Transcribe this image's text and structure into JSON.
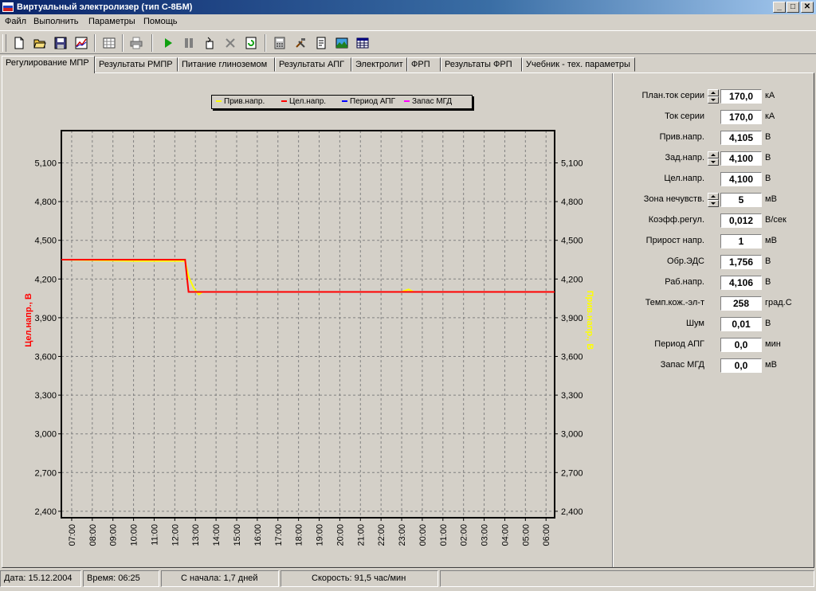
{
  "window": {
    "title": "Виртуальный электролизер (тип С-8БМ)"
  },
  "menu": [
    "Файл",
    "Выполнить",
    "Параметры",
    "Помощь"
  ],
  "toolbar": {
    "buttons": [
      "new-icon",
      "open-icon",
      "save-icon",
      "chart-icon",
      "grid-icon",
      "print-icon",
      "play-icon",
      "pause-icon",
      "step-icon",
      "stop-icon",
      "refresh-icon",
      "calculator-icon",
      "tools-icon",
      "notes-icon",
      "landscape-icon",
      "table-icon"
    ]
  },
  "tabs": [
    "Регулирование МПР",
    "Результаты РМПР",
    "Питание глиноземом",
    "Результаты АПГ",
    "Электролит",
    "ФРП",
    "Результаты ФРП",
    "Учебник - тех. параметры"
  ],
  "active_tab": 0,
  "chart_data": {
    "type": "line",
    "legend": [
      "Прив.напр.",
      "Цел.напр.",
      "Период АПГ",
      "Запас МГД"
    ],
    "legend_colors": [
      "#ffff00",
      "#ff0000",
      "#0000ff",
      "#ff00ff"
    ],
    "ylabel_left": "Цел.напр., В",
    "ylabel_right": "Прив.напр., В",
    "y_ticks": [
      "5,100",
      "4,800",
      "4,500",
      "4,200",
      "3,900",
      "3,600",
      "3,300",
      "3,000",
      "2,700",
      "2,400"
    ],
    "ylim": [
      2.35,
      5.35
    ],
    "x_ticks": [
      "07:00",
      "08:00",
      "09:00",
      "10:00",
      "11:00",
      "12:00",
      "13:00",
      "14:00",
      "15:00",
      "16:00",
      "17:00",
      "18:00",
      "19:00",
      "20:00",
      "21:00",
      "22:00",
      "23:00",
      "00:00",
      "01:00",
      "02:00",
      "03:00",
      "04:00",
      "05:00",
      "06:00"
    ],
    "xlim": [
      "06:30",
      "06:25"
    ],
    "series": [
      {
        "name": "Цел.напр.",
        "color": "#ff0000",
        "points": [
          [
            "06:30",
            4.35
          ],
          [
            "12:30",
            4.35
          ],
          [
            "12:40",
            4.1
          ],
          [
            "06:25",
            4.1
          ]
        ]
      },
      {
        "name": "Прив.напр.",
        "color": "#ffff00",
        "points": [
          [
            "06:30",
            4.35
          ],
          [
            "10:00",
            4.34
          ],
          [
            "12:30",
            4.34
          ],
          [
            "12:40",
            4.22
          ],
          [
            "12:55",
            4.13
          ],
          [
            "13:10",
            4.08
          ],
          [
            "13:20",
            4.1
          ],
          [
            "23:00",
            4.1
          ],
          [
            "23:20",
            4.12
          ],
          [
            "23:35",
            4.1
          ],
          [
            "06:25",
            4.1
          ]
        ]
      }
    ],
    "grid": true
  },
  "params": [
    {
      "label": "План.ток серии",
      "value": "170,0",
      "unit": "кА",
      "spinner": true
    },
    {
      "label": "Ток серии",
      "value": "170,0",
      "unit": "кА",
      "spinner": false
    },
    {
      "label": "Прив.напр.",
      "value": "4,105",
      "unit": "В",
      "spinner": false
    },
    {
      "label": "Зад.напр.",
      "value": "4,100",
      "unit": "В",
      "spinner": true
    },
    {
      "label": "Цел.напр.",
      "value": "4,100",
      "unit": "В",
      "spinner": false
    },
    {
      "label": "Зона нечувств.",
      "value": "5",
      "unit": "мВ",
      "spinner": true
    },
    {
      "label": "Коэфф.регул.",
      "value": "0,012",
      "unit": "В/сек",
      "spinner": false
    },
    {
      "label": "Прирост напр.",
      "value": "1",
      "unit": "мВ",
      "spinner": false
    },
    {
      "label": "Обр.ЭДС",
      "value": "1,756",
      "unit": "В",
      "spinner": false
    },
    {
      "label": "Раб.напр.",
      "value": "4,106",
      "unit": "В",
      "spinner": false
    },
    {
      "label": "Темп.кож.-эл-т",
      "value": "258",
      "unit": "град.С",
      "spinner": false
    },
    {
      "label": "Шум",
      "value": "0,01",
      "unit": "В",
      "spinner": false
    },
    {
      "label": "Период АПГ",
      "value": "0,0",
      "unit": "мин",
      "spinner": false
    },
    {
      "label": "Запас МГД",
      "value": "0,0",
      "unit": "мВ",
      "spinner": false
    }
  ],
  "status": {
    "date": "Дата: 15.12.2004",
    "time": "Время: 06:25",
    "since": "С начала: 1,7 дней",
    "speed": "Скорость: 91,5 час/мин"
  }
}
